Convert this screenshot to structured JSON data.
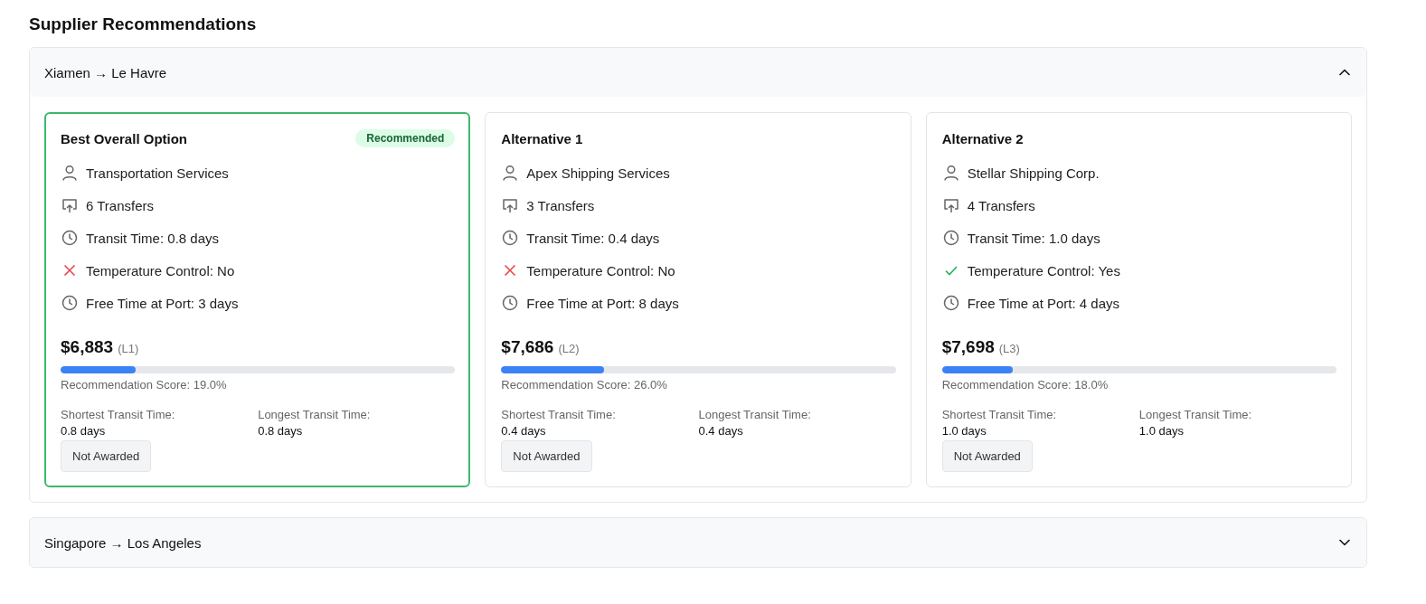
{
  "title": "Supplier Recommendations",
  "routes": [
    {
      "route": "Xiamen → Le Havre",
      "expanded": true,
      "cards": [
        {
          "title": "Best Overall Option",
          "selected": true,
          "badge": "Recommended",
          "rows": [
            {
              "kind": "supplier",
              "text": "Transportation Services"
            },
            {
              "kind": "transfers",
              "text": "6 Transfers"
            },
            {
              "kind": "time",
              "text": "Transit Time: 0.8 days"
            },
            {
              "kind": "temperature",
              "checked": false,
              "text": "Temperature Control: No"
            },
            {
              "kind": "time",
              "text": "Free Time at Port: 3 days"
            }
          ],
          "price": "$6,883",
          "rank": "(L1)",
          "level": 0.19,
          "score": "Recommendation Score: 19.0%",
          "stats": [
            {
              "label": "Shortest Transit Time:",
              "value": "0.8 days"
            },
            {
              "label": "Longest Transit Time:",
              "value": "0.8 days"
            }
          ],
          "button": "Not Awarded"
        },
        {
          "title": "Alternative 1",
          "selected": false,
          "rows": [
            {
              "kind": "supplier",
              "text": "Apex Shipping Services"
            },
            {
              "kind": "transfers",
              "text": "3 Transfers"
            },
            {
              "kind": "time",
              "text": "Transit Time: 0.4 days"
            },
            {
              "kind": "temperature",
              "checked": false,
              "text": "Temperature Control: No"
            },
            {
              "kind": "time",
              "text": "Free Time at Port: 8 days"
            }
          ],
          "price": "$7,686",
          "rank": "(L2)",
          "level": 0.26,
          "score": "Recommendation Score: 26.0%",
          "stats": [
            {
              "label": "Shortest Transit Time:",
              "value": "0.4 days"
            },
            {
              "label": "Longest Transit Time:",
              "value": "0.4 days"
            }
          ],
          "button": "Not Awarded"
        },
        {
          "title": "Alternative 2",
          "selected": false,
          "rows": [
            {
              "kind": "supplier",
              "text": "Stellar Shipping Corp."
            },
            {
              "kind": "transfers",
              "text": "4 Transfers"
            },
            {
              "kind": "time",
              "text": "Transit Time: 1.0 days"
            },
            {
              "kind": "temperature",
              "checked": true,
              "text": "Temperature Control: Yes"
            },
            {
              "kind": "time",
              "text": "Free Time at Port: 4 days"
            }
          ],
          "price": "$7,698",
          "rank": "(L3)",
          "level": 0.18,
          "score": "Recommendation Score: 18.0%",
          "stats": [
            {
              "label": "Shortest Transit Time:",
              "value": "1.0 days"
            },
            {
              "label": "Longest Transit Time:",
              "value": "1.0 days"
            }
          ],
          "button": "Not Awarded"
        }
      ]
    },
    {
      "route": "Singapore → Los Angeles",
      "expanded": false
    }
  ]
}
